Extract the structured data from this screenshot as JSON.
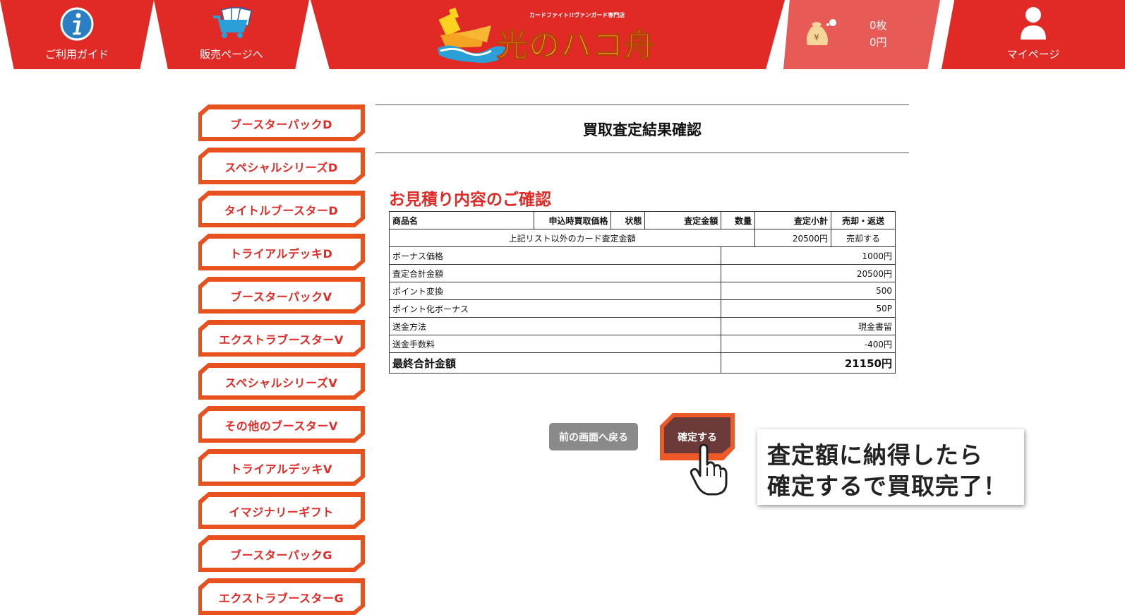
{
  "header": {
    "guide_label": "ご利用ガイド",
    "sales_label": "販売ページへ",
    "logo_title": "光のハコ舟",
    "logo_subtitle": "カードファイト!!ヴァンガード専門店",
    "cart_count": "0枚",
    "cart_total": "0円",
    "cart_bag_mark": "¥",
    "mypage_label": "マイページ"
  },
  "sidebar": {
    "items": [
      {
        "label": "ブースターパックD"
      },
      {
        "label": "スペシャルシリーズD"
      },
      {
        "label": "タイトルブースターD"
      },
      {
        "label": "トライアルデッキD"
      },
      {
        "label": "ブースターパックV"
      },
      {
        "label": "エクストラブースターV"
      },
      {
        "label": "スペシャルシリーズV"
      },
      {
        "label": "その他のブースターV"
      },
      {
        "label": "トライアルデッキV"
      },
      {
        "label": "イマジナリーギフト"
      },
      {
        "label": "ブースターパックG"
      },
      {
        "label": "エクストラブースターG"
      }
    ]
  },
  "main": {
    "page_title": "買取査定結果確認",
    "section_title": "お見積り内容のご確認",
    "table": {
      "headers": {
        "name": "商品名",
        "apply_price": "申込時買取価格",
        "condition": "状態",
        "assessed": "査定金額",
        "quantity": "数量",
        "subtotal": "査定小計",
        "sell_return": "売却・返送"
      },
      "item_row": {
        "name": "上記リスト以外のカード査定金額",
        "subtotal": "20500円",
        "sell_return": "売却する"
      },
      "summary": [
        {
          "label": "ボーナス価格",
          "value": "1000円"
        },
        {
          "label": "査定合計金額",
          "value": "20500円"
        },
        {
          "label": "ポイント変換",
          "value": "500"
        },
        {
          "label": "ポイント化ボーナス",
          "value": "50P"
        },
        {
          "label": "送金方法",
          "value": "現金書留"
        },
        {
          "label": "送金手数料",
          "value": "-400円"
        }
      ],
      "final": {
        "label": "最終合計金額",
        "value": "21150円"
      }
    },
    "back_button": "前の画面へ戻る",
    "confirm_button": "確定する"
  },
  "callout": {
    "line1": "査定額に納得したら",
    "line2": "確定するで買取完了！"
  },
  "colors": {
    "header_red": "#e12a25",
    "cart_red": "#e85a56",
    "sidebar_orange": "#e8501e",
    "confirm_dark": "#6d3a3a",
    "back_gray": "#8a8a8a"
  }
}
